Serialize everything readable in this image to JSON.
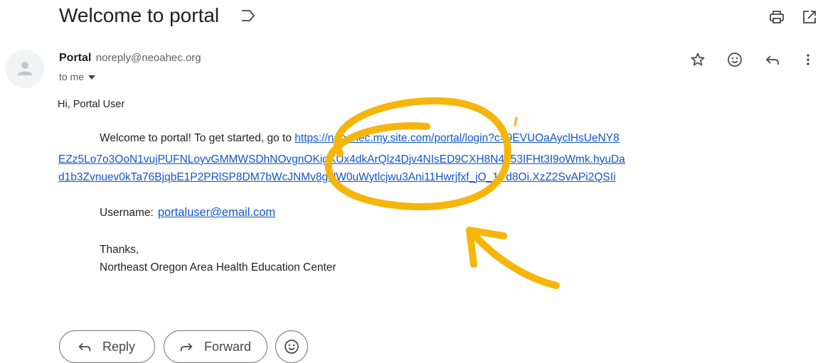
{
  "email": {
    "subject": "Welcome to portal",
    "sender_name": "Portal",
    "sender_email": "noreply@neoahec.org",
    "to_label": "to me",
    "greeting": "Hi, Portal User",
    "intro_text": "Welcome to portal! To get started, go to ",
    "link_part1": "https://neoahec.my.site.com/portal/login?c=9EVUOaAyclHsUeNY8",
    "link_part2": "EZz5Lo7o3OoN1vujPUFNLoyvGMMWSDhNOvgnOKigXUx4dkArQlz4Djv4NIsED9CXH8N4n53IFHt3I9oWmk.hyuDa",
    "link_part3": "d1b3Zvnuev0kTa76BjqbE1P2PRlSP8DM7bWcJNMv8gslW0uWytlcjwu3Ani11Hwrjfxf_jO_1Vd8Oi.XzZ2SvAPi2QSIi",
    "username_label": "Username:",
    "username_value": "portaluser@email.com",
    "signoff": "Thanks,",
    "organization": "Northeast Oregon Area Health Education Center"
  },
  "actions": {
    "reply_label": "Reply",
    "forward_label": "Forward"
  },
  "icons": {
    "label": "label-outline-icon",
    "print": "print-icon",
    "open_new": "open-in-new-window-icon",
    "star": "star-icon",
    "emoji": "emoji-reaction-icon",
    "reply": "reply-arrow-icon",
    "more": "more-vertical-icon",
    "forward": "forward-arrow-icon"
  },
  "colors": {
    "link": "#1155cc",
    "annotation": "#f5b50a",
    "avatar_bg": "#f1f3f4"
  }
}
